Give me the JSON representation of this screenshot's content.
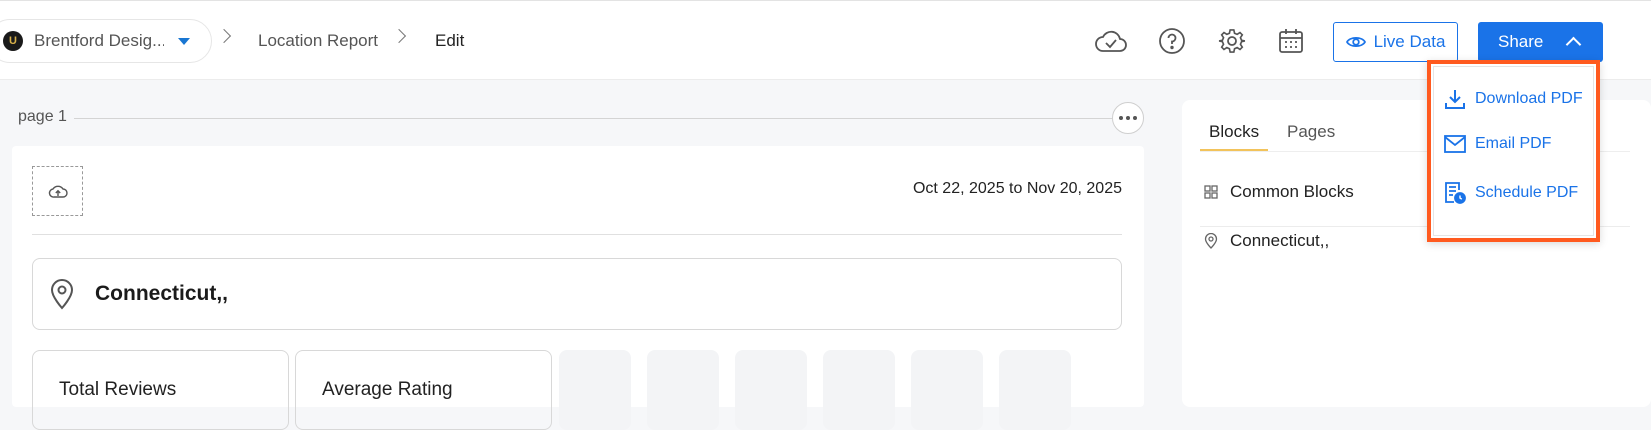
{
  "header": {
    "workspace_logo": "U",
    "workspace_name": "Brentford Desig...",
    "breadcrumbs": [
      "Location Report",
      "Edit"
    ],
    "icons": [
      "cloud-check-icon",
      "help-icon",
      "settings-icon",
      "calendar-icon"
    ],
    "live_data_label": "Live Data",
    "share_label": "Share"
  },
  "share_menu": {
    "items": [
      {
        "label": "Download PDF",
        "icon": "download-icon"
      },
      {
        "label": "Email PDF",
        "icon": "mail-icon"
      },
      {
        "label": "Schedule PDF",
        "icon": "schedule-icon"
      }
    ]
  },
  "canvas": {
    "page_label": "page 1",
    "date_range": "Oct 22, 2025 to Nov 20, 2025",
    "location_name": "Connecticut,,",
    "metrics": [
      "Total Reviews",
      "Average Rating"
    ]
  },
  "panel": {
    "tabs": [
      "Blocks",
      "Pages"
    ],
    "items": [
      "Common Blocks",
      "Connecticut,,"
    ]
  },
  "colors": {
    "accent": "#1a73e8",
    "highlight": "#ff5a1f",
    "tab_underline": "#f2c35b"
  }
}
